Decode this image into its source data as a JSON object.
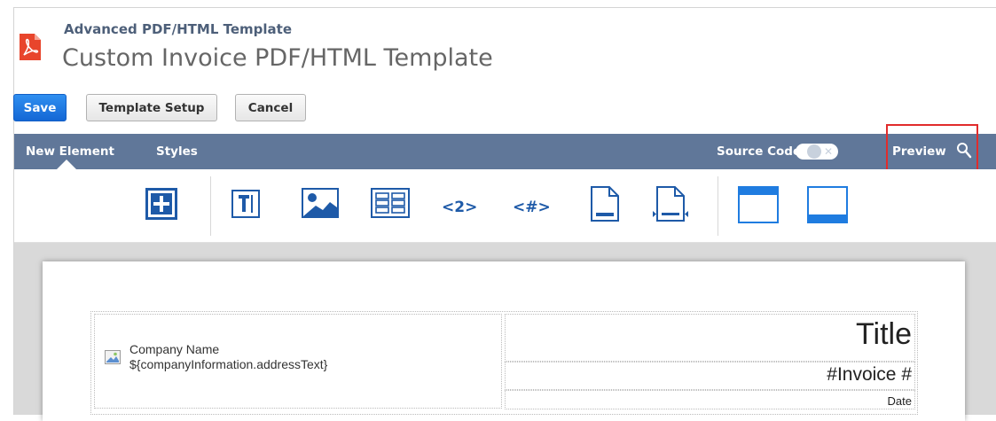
{
  "header": {
    "subtitle": "Advanced PDF/HTML Template",
    "title": "Custom Invoice PDF/HTML Template",
    "icon": "pdf-file-icon"
  },
  "buttons": {
    "save": "Save",
    "template_setup": "Template Setup",
    "cancel": "Cancel"
  },
  "nav": {
    "new_element": "New Element",
    "styles": "Styles",
    "source_code": "Source Code",
    "source_code_toggle": "off",
    "preview": "Preview"
  },
  "toolbar": {
    "tools": [
      {
        "name": "add-element-icon"
      },
      {
        "name": "text-field-icon"
      },
      {
        "name": "image-icon"
      },
      {
        "name": "table-icon"
      },
      {
        "name": "page-number-label",
        "label": "<2>"
      },
      {
        "name": "total-pages-label",
        "label": "<#>"
      },
      {
        "name": "page-break-icon"
      },
      {
        "name": "insert-break-icon"
      },
      {
        "name": "header-layout-icon"
      },
      {
        "name": "footer-layout-icon"
      }
    ]
  },
  "document": {
    "company_name": "Company Name",
    "company_address": "${companyInformation.addressText}",
    "title": "Title",
    "invoice_number": "#Invoice #",
    "date": "Date"
  },
  "colors": {
    "navbar": "#607799",
    "save_button": "#1c75e0",
    "icon_blue": "#1e5aa8",
    "accent_blue": "#1f7ce0",
    "highlight_red": "#e12c2c",
    "pdf_red": "#e8452c"
  }
}
